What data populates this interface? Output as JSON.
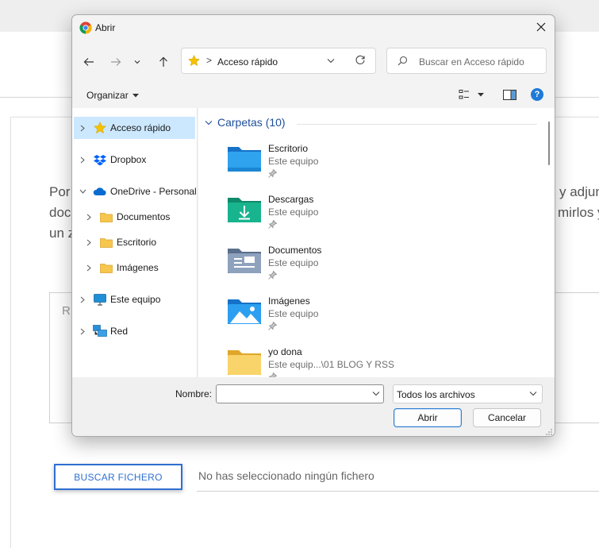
{
  "background": {
    "paragraph_lines": [
      {
        "left": "Por",
        "right": "y adjunta"
      },
      {
        "left": "doc",
        "right": "mirlos y"
      },
      {
        "left": "un z",
        "right": ""
      }
    ],
    "textarea_placeholder": "R",
    "upload_button_label": "BUSCAR FICHERO",
    "file_status": "No has seleccionado ningún fichero"
  },
  "dialog": {
    "title": "Abrir",
    "address": {
      "separator": ">",
      "location": "Acceso rápido"
    },
    "search_placeholder": "Buscar en Acceso rápido",
    "organize_label": "Organizar",
    "help_label": "?",
    "nav_items": [
      {
        "label": "Acceso rápido",
        "icon": "star-icon",
        "chevron": ">",
        "selected": true
      },
      {
        "label": "Dropbox",
        "icon": "dropbox-icon",
        "chevron": ">"
      },
      {
        "label": "OneDrive - Personal",
        "icon": "onedrive-icon",
        "chevron": "v",
        "expanded": true
      },
      {
        "label": "Documentos",
        "icon": "folder-icon",
        "chevron": ">"
      },
      {
        "label": "Escritorio",
        "icon": "folder-icon",
        "chevron": ">"
      },
      {
        "label": "Imágenes",
        "icon": "folder-icon",
        "chevron": ">"
      },
      {
        "label": "Este equipo",
        "icon": "computer-icon",
        "chevron": ">"
      },
      {
        "label": "Red",
        "icon": "network-icon",
        "chevron": ">"
      }
    ],
    "group_header": "Carpetas (10)",
    "folders": [
      {
        "name": "Escritorio",
        "location": "Este equipo",
        "icon": "desktop-folder-icon"
      },
      {
        "name": "Descargas",
        "location": "Este equipo",
        "icon": "downloads-folder-icon"
      },
      {
        "name": "Documentos",
        "location": "Este equipo",
        "icon": "documents-folder-icon"
      },
      {
        "name": "Imágenes",
        "location": "Este equipo",
        "icon": "pictures-folder-icon"
      },
      {
        "name": "yo dona",
        "location": "Este equip...\\01 BLOG Y RSS",
        "icon": "folder-icon"
      }
    ],
    "filename_label": "Nombre:",
    "filename_value": "",
    "file_type": "Todos los archivos",
    "open_button": "Abrir",
    "cancel_button": "Cancelar"
  },
  "colors": {
    "accent": "#2d7dd2",
    "selection": "#cce8ff",
    "group_header": "#1e4e9c",
    "folder_yellow": "#f6c64d"
  }
}
